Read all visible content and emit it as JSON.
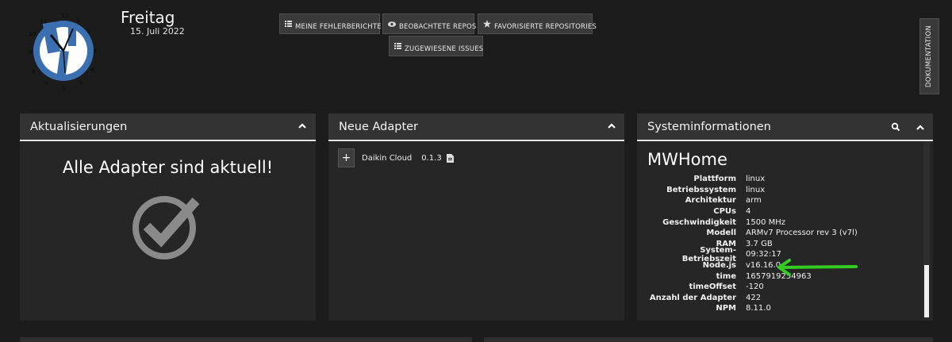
{
  "header": {
    "day": "Freitag",
    "date": "15. Juli 2022"
  },
  "toolbar": {
    "my_bug_reports": "MEINE FEHLERBERICHTE",
    "watched_repos": "BEOBACHTETE REPOS",
    "favorite_repos": "FAVORISIERTE REPOSITORIES",
    "assigned_issues": "ZUGEWIESENE ISSUES"
  },
  "documentation_label": "DOKUMENTATION",
  "updates_card": {
    "title": "Aktualisierungen",
    "message": "Alle Adapter sind aktuell!"
  },
  "new_adapters_card": {
    "title": "Neue Adapter",
    "plus_label": "+",
    "adapters": [
      {
        "name": "Daikin Cloud",
        "version": "0.1.3"
      }
    ]
  },
  "sysinfo_card": {
    "title": "Systeminformationen",
    "hostname": "MWHome",
    "rows": [
      {
        "key": "Plattform",
        "value": "linux"
      },
      {
        "key": "Betriebssystem",
        "value": "linux"
      },
      {
        "key": "Architektur",
        "value": "arm"
      },
      {
        "key": "CPUs",
        "value": "4"
      },
      {
        "key": "Geschwindigkeit",
        "value": "1500 MHz"
      },
      {
        "key": "Modell",
        "value": "ARMv7 Processor rev 3 (v7l)"
      },
      {
        "key": "RAM",
        "value": "3.7 GB"
      },
      {
        "key": "System-Betriebszeit",
        "value": "09:32:17"
      },
      {
        "key": "Node.js",
        "value": "v16.16.0"
      },
      {
        "key": "time",
        "value": "1657919254963"
      },
      {
        "key": "timeOffset",
        "value": "-120"
      },
      {
        "key": "Anzahl der Adapter",
        "value": "422"
      },
      {
        "key": "NPM",
        "value": "8.11.0"
      }
    ]
  },
  "colors": {
    "background": "#1c1c1c",
    "card": "#262626",
    "card_header": "#333333",
    "annotation_arrow": "#33cc22",
    "logo_blue": "#3c6fb0"
  }
}
